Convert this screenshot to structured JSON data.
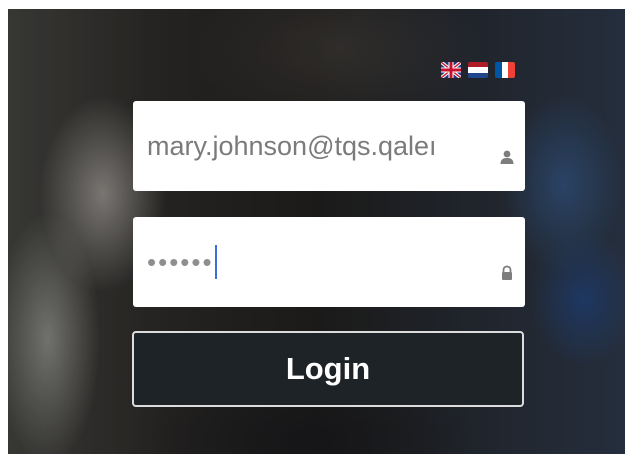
{
  "languages": [
    {
      "icon": "uk-flag-icon"
    },
    {
      "icon": "netherlands-flag-icon"
    },
    {
      "icon": "france-flag-icon"
    }
  ],
  "login_form": {
    "email": {
      "value": "mary.johnson@tqs.qaleı",
      "icon": "user-icon"
    },
    "password": {
      "value": "••••••",
      "icon": "lock-icon"
    },
    "submit_label": "Login"
  },
  "colors": {
    "button_background": "#1d2327",
    "button_border": "#dcdcdc",
    "caret": "#3a6fd8",
    "field_text": "#7b7b7b"
  }
}
